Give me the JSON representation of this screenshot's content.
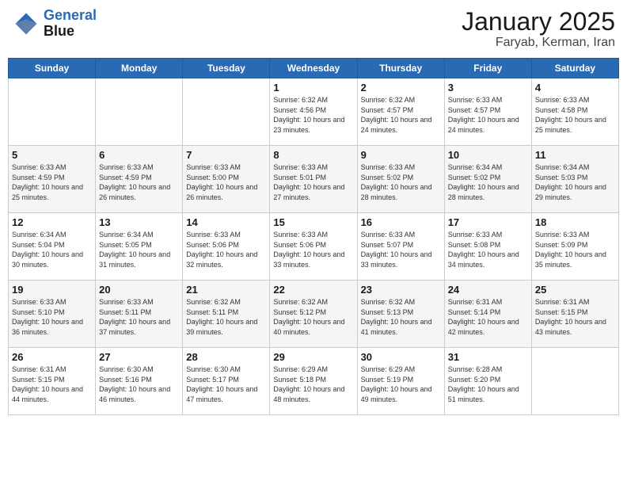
{
  "header": {
    "logo_line1": "General",
    "logo_line2": "Blue",
    "title": "January 2025",
    "subtitle": "Faryab, Kerman, Iran"
  },
  "weekdays": [
    "Sunday",
    "Monday",
    "Tuesday",
    "Wednesday",
    "Thursday",
    "Friday",
    "Saturday"
  ],
  "weeks": [
    [
      {
        "day": "",
        "sunrise": "",
        "sunset": "",
        "daylight": ""
      },
      {
        "day": "",
        "sunrise": "",
        "sunset": "",
        "daylight": ""
      },
      {
        "day": "",
        "sunrise": "",
        "sunset": "",
        "daylight": ""
      },
      {
        "day": "1",
        "sunrise": "6:32 AM",
        "sunset": "4:56 PM",
        "daylight": "10 hours and 23 minutes."
      },
      {
        "day": "2",
        "sunrise": "6:32 AM",
        "sunset": "4:57 PM",
        "daylight": "10 hours and 24 minutes."
      },
      {
        "day": "3",
        "sunrise": "6:33 AM",
        "sunset": "4:57 PM",
        "daylight": "10 hours and 24 minutes."
      },
      {
        "day": "4",
        "sunrise": "6:33 AM",
        "sunset": "4:58 PM",
        "daylight": "10 hours and 25 minutes."
      }
    ],
    [
      {
        "day": "5",
        "sunrise": "6:33 AM",
        "sunset": "4:59 PM",
        "daylight": "10 hours and 25 minutes."
      },
      {
        "day": "6",
        "sunrise": "6:33 AM",
        "sunset": "4:59 PM",
        "daylight": "10 hours and 26 minutes."
      },
      {
        "day": "7",
        "sunrise": "6:33 AM",
        "sunset": "5:00 PM",
        "daylight": "10 hours and 26 minutes."
      },
      {
        "day": "8",
        "sunrise": "6:33 AM",
        "sunset": "5:01 PM",
        "daylight": "10 hours and 27 minutes."
      },
      {
        "day": "9",
        "sunrise": "6:33 AM",
        "sunset": "5:02 PM",
        "daylight": "10 hours and 28 minutes."
      },
      {
        "day": "10",
        "sunrise": "6:34 AM",
        "sunset": "5:02 PM",
        "daylight": "10 hours and 28 minutes."
      },
      {
        "day": "11",
        "sunrise": "6:34 AM",
        "sunset": "5:03 PM",
        "daylight": "10 hours and 29 minutes."
      }
    ],
    [
      {
        "day": "12",
        "sunrise": "6:34 AM",
        "sunset": "5:04 PM",
        "daylight": "10 hours and 30 minutes."
      },
      {
        "day": "13",
        "sunrise": "6:34 AM",
        "sunset": "5:05 PM",
        "daylight": "10 hours and 31 minutes."
      },
      {
        "day": "14",
        "sunrise": "6:33 AM",
        "sunset": "5:06 PM",
        "daylight": "10 hours and 32 minutes."
      },
      {
        "day": "15",
        "sunrise": "6:33 AM",
        "sunset": "5:06 PM",
        "daylight": "10 hours and 33 minutes."
      },
      {
        "day": "16",
        "sunrise": "6:33 AM",
        "sunset": "5:07 PM",
        "daylight": "10 hours and 33 minutes."
      },
      {
        "day": "17",
        "sunrise": "6:33 AM",
        "sunset": "5:08 PM",
        "daylight": "10 hours and 34 minutes."
      },
      {
        "day": "18",
        "sunrise": "6:33 AM",
        "sunset": "5:09 PM",
        "daylight": "10 hours and 35 minutes."
      }
    ],
    [
      {
        "day": "19",
        "sunrise": "6:33 AM",
        "sunset": "5:10 PM",
        "daylight": "10 hours and 36 minutes."
      },
      {
        "day": "20",
        "sunrise": "6:33 AM",
        "sunset": "5:11 PM",
        "daylight": "10 hours and 37 minutes."
      },
      {
        "day": "21",
        "sunrise": "6:32 AM",
        "sunset": "5:11 PM",
        "daylight": "10 hours and 39 minutes."
      },
      {
        "day": "22",
        "sunrise": "6:32 AM",
        "sunset": "5:12 PM",
        "daylight": "10 hours and 40 minutes."
      },
      {
        "day": "23",
        "sunrise": "6:32 AM",
        "sunset": "5:13 PM",
        "daylight": "10 hours and 41 minutes."
      },
      {
        "day": "24",
        "sunrise": "6:31 AM",
        "sunset": "5:14 PM",
        "daylight": "10 hours and 42 minutes."
      },
      {
        "day": "25",
        "sunrise": "6:31 AM",
        "sunset": "5:15 PM",
        "daylight": "10 hours and 43 minutes."
      }
    ],
    [
      {
        "day": "26",
        "sunrise": "6:31 AM",
        "sunset": "5:15 PM",
        "daylight": "10 hours and 44 minutes."
      },
      {
        "day": "27",
        "sunrise": "6:30 AM",
        "sunset": "5:16 PM",
        "daylight": "10 hours and 46 minutes."
      },
      {
        "day": "28",
        "sunrise": "6:30 AM",
        "sunset": "5:17 PM",
        "daylight": "10 hours and 47 minutes."
      },
      {
        "day": "29",
        "sunrise": "6:29 AM",
        "sunset": "5:18 PM",
        "daylight": "10 hours and 48 minutes."
      },
      {
        "day": "30",
        "sunrise": "6:29 AM",
        "sunset": "5:19 PM",
        "daylight": "10 hours and 49 minutes."
      },
      {
        "day": "31",
        "sunrise": "6:28 AM",
        "sunset": "5:20 PM",
        "daylight": "10 hours and 51 minutes."
      },
      {
        "day": "",
        "sunrise": "",
        "sunset": "",
        "daylight": ""
      }
    ]
  ]
}
